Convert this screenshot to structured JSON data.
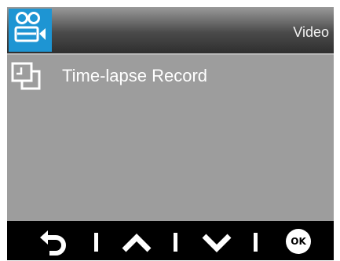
{
  "header": {
    "mode_icon": "video-camera-icon",
    "title": "Video"
  },
  "menu": {
    "items": [
      {
        "icon": "time-lapse-icon",
        "label": "Time-lapse Record"
      }
    ]
  },
  "footer": {
    "buttons": [
      {
        "icon": "back-arrow-icon"
      },
      {
        "icon": "chevron-up-icon"
      },
      {
        "icon": "chevron-down-icon"
      },
      {
        "icon": "ok-icon",
        "label": "OK"
      }
    ]
  },
  "colors": {
    "accent": "#1e95d3",
    "screen_background": "#9d9d9d",
    "footer_background": "#000000",
    "text": "#ffffff"
  }
}
